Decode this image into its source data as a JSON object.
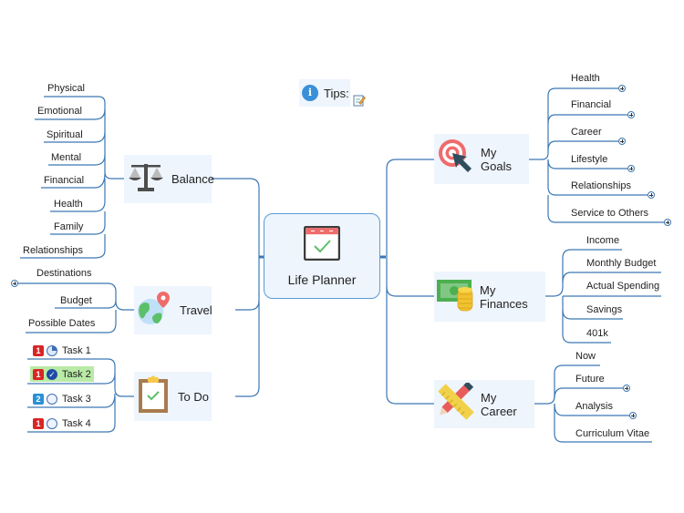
{
  "tips": {
    "label": "Tips:",
    "icon": "info-icon",
    "note_icon": "note-edit-icon"
  },
  "central": {
    "title": "Life Planner",
    "icon": "calendar-check-icon"
  },
  "colors": {
    "line": "#3c78b4",
    "node_bg": "#eef5fd",
    "center_border": "#5b9bd5"
  },
  "branches": {
    "balance": {
      "label": "Balance",
      "icon": "scales-icon",
      "children": [
        "Physical",
        "Emotional",
        "Spiritual",
        "Mental",
        "Financial",
        "Health",
        "Family",
        "Relationships"
      ]
    },
    "travel": {
      "label": "Travel",
      "icon": "globe-pin-icon",
      "children": [
        "Destinations",
        "Budget",
        "Possible Dates"
      ]
    },
    "todo": {
      "label": "To Do",
      "icon": "clipboard-check-icon",
      "tasks": [
        {
          "label": "Task 1",
          "priority": "1",
          "progress": "25%",
          "highlight": false
        },
        {
          "label": "Task 2",
          "priority": "1",
          "progress": "100%",
          "highlight": true
        },
        {
          "label": "Task 3",
          "priority": "2",
          "progress": "0%",
          "highlight": false
        },
        {
          "label": "Task 4",
          "priority": "1",
          "progress": "0%",
          "highlight": false
        }
      ]
    },
    "goals": {
      "label": "My Goals",
      "icon": "target-arrow-icon",
      "children": [
        "Health",
        "Financial",
        "Career",
        "Lifestyle",
        "Relationships",
        "Service to Others"
      ]
    },
    "finances": {
      "label": "My Finances",
      "icon": "money-coins-icon",
      "children": [
        "Income",
        "Monthly Budget",
        "Actual Spending",
        "Savings",
        "401k"
      ]
    },
    "career": {
      "label": "My Career",
      "icon": "ruler-pencil-icon",
      "children": [
        "Now",
        "Future",
        "Analysis",
        "Curriculum Vitae"
      ]
    }
  }
}
